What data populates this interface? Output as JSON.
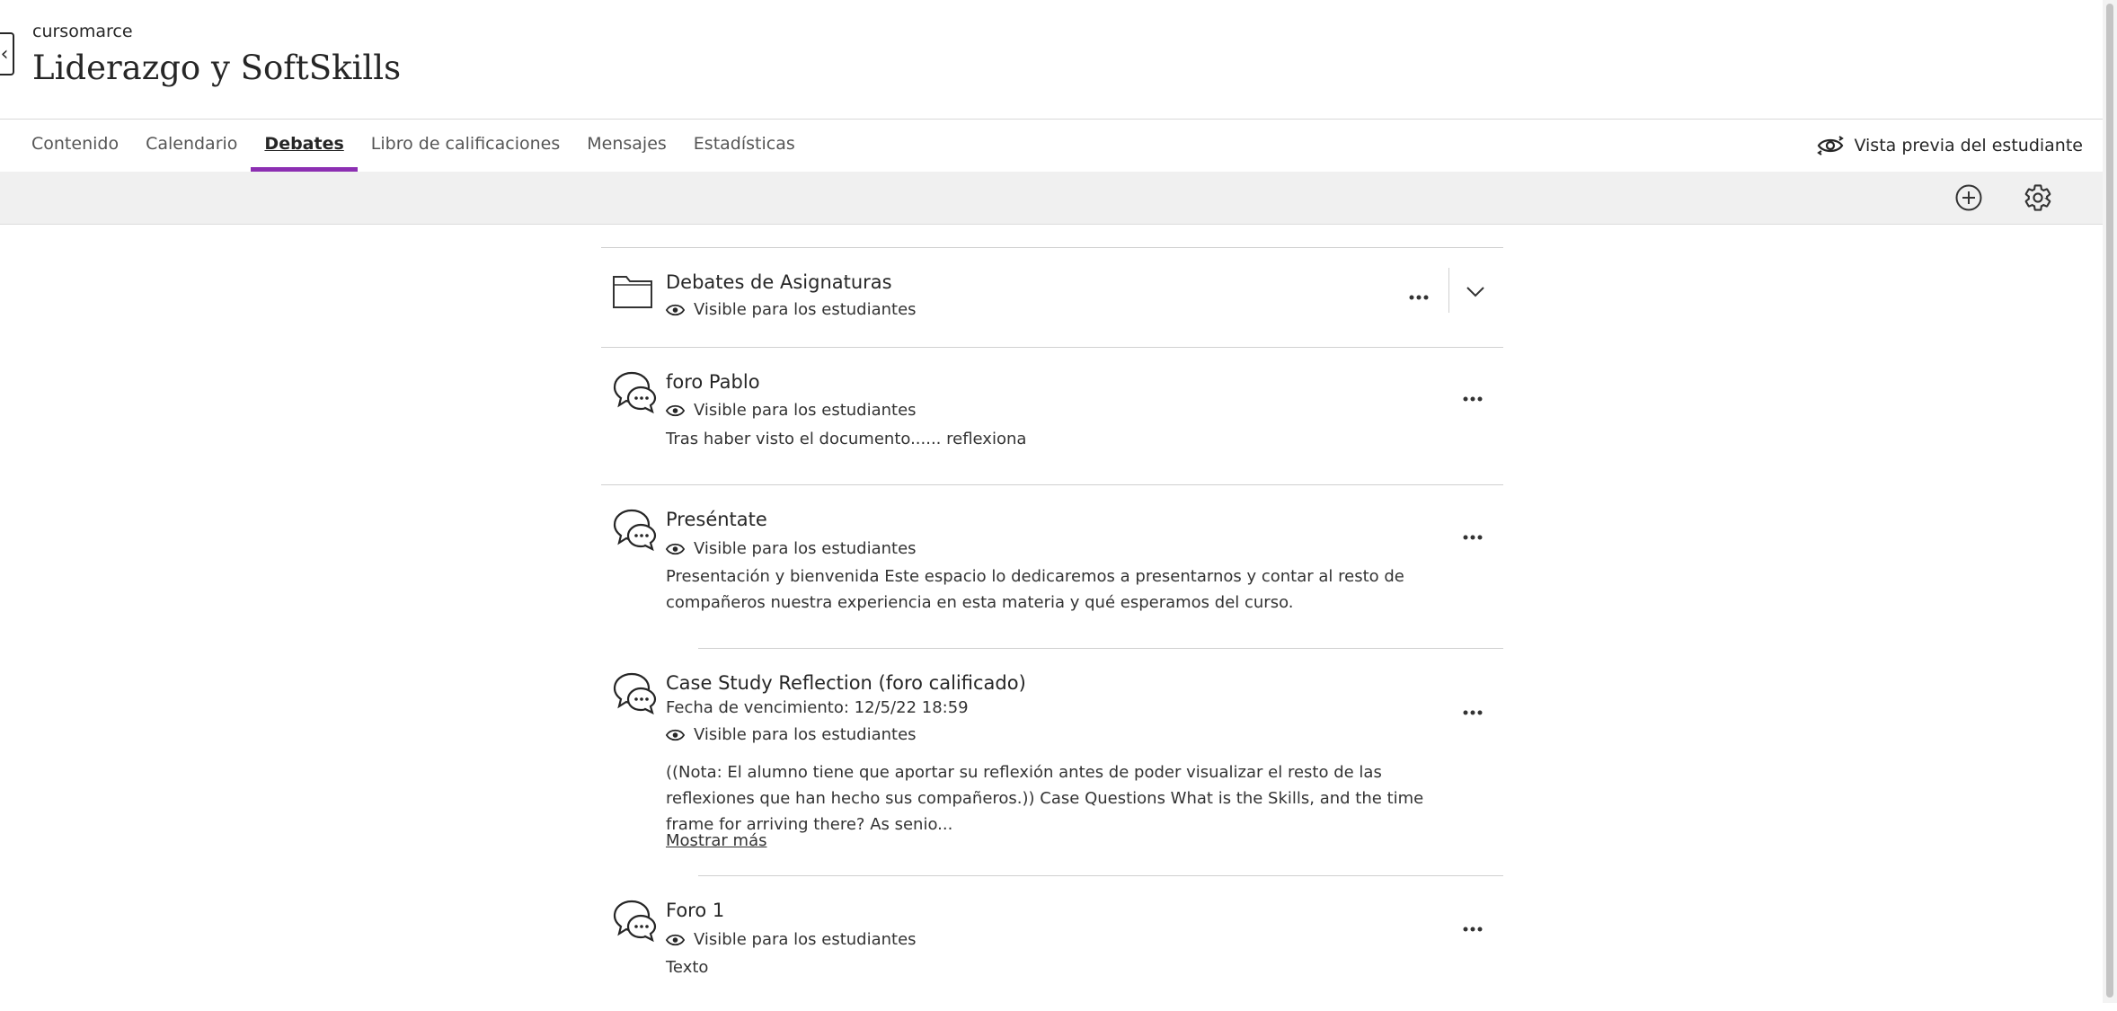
{
  "header": {
    "org": "cursomarce",
    "title": "Liderazgo y SoftSkills"
  },
  "nav": {
    "tabs": [
      {
        "label": "Contenido"
      },
      {
        "label": "Calendario"
      },
      {
        "label": "Debates"
      },
      {
        "label": "Libro de calificaciones"
      },
      {
        "label": "Mensajes"
      },
      {
        "label": "Estadísticas"
      }
    ],
    "active_tab": "Debates",
    "student_preview": "Vista previa del estudiante"
  },
  "toolbar": {
    "add_icon": "plus-circle-icon",
    "settings_icon": "gear-icon"
  },
  "items": [
    {
      "type": "folder",
      "title": "Debates de Asignaturas",
      "visibility": "Visible para los estudiantes"
    },
    {
      "type": "discussion",
      "title": "foro Pablo",
      "visibility": "Visible para los estudiantes",
      "description": "Tras haber visto el documento...... reflexiona"
    },
    {
      "type": "discussion",
      "title": "Preséntate",
      "visibility": "Visible para los estudiantes",
      "description": "Presentación y bienvenida Este espacio lo dedicaremos a presentarnos y contar al resto de compañeros nuestra experiencia en esta materia y qué esperamos del curso."
    },
    {
      "type": "discussion",
      "title": "Case Study Reflection (foro calificado)",
      "due": "Fecha de vencimiento: 12/5/22 18:59",
      "visibility": "Visible para los estudiantes",
      "description": "((Nota: El alumno tiene que aportar su reflexión antes de poder visualizar el resto de las reflexiones que han hecho sus compañeros.)) Case Questions What is the Skills, and the time frame for arriving there? As senio...",
      "show_more": "Mostrar más"
    },
    {
      "type": "discussion",
      "title": "Foro 1",
      "visibility": "Visible para los estudiantes",
      "description": "Texto"
    }
  ],
  "colors": {
    "accent": "#8c2fb2",
    "toolbar_bg": "#f0f0f0",
    "divider": "#d0d0d0"
  }
}
